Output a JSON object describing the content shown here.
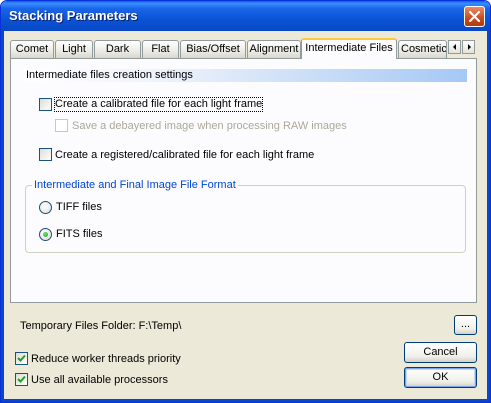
{
  "window": {
    "title": "Stacking Parameters"
  },
  "tabs": [
    {
      "label": "Comet"
    },
    {
      "label": "Light"
    },
    {
      "label": "Dark"
    },
    {
      "label": "Flat"
    },
    {
      "label": "Bias/Offset"
    },
    {
      "label": "Alignment"
    },
    {
      "label": "Intermediate Files",
      "active": true
    },
    {
      "label": "Cosmetic"
    }
  ],
  "panel": {
    "section_header": "Intermediate files creation settings",
    "options": {
      "calibrated_file": {
        "label": "Create a calibrated file for each light frame",
        "checked": false
      },
      "debayered": {
        "label": "Save a debayered image when processing RAW images",
        "checked": false,
        "enabled": false
      },
      "registered_file": {
        "label": "Create a registered/calibrated file for each light frame",
        "checked": false
      }
    },
    "format_group": {
      "title": "Intermediate and Final Image File Format",
      "tiff": {
        "label": "TIFF files",
        "selected": false
      },
      "fits": {
        "label": "FITS files",
        "selected": true
      }
    }
  },
  "footer": {
    "temp_folder_label": "Temporary Files Folder: F:\\Temp\\",
    "browse_label": "...",
    "reduce_priority": {
      "label": "Reduce worker threads priority",
      "checked": true
    },
    "use_all_processors": {
      "label": "Use all available processors",
      "checked": true
    },
    "cancel_label": "Cancel",
    "ok_label": "OK"
  },
  "colors": {
    "title_bar": "#0a54d6",
    "dialog_bg": "#ece9d8",
    "group_title": "#0046d5",
    "active_tab_highlight": "#ffc83c"
  }
}
